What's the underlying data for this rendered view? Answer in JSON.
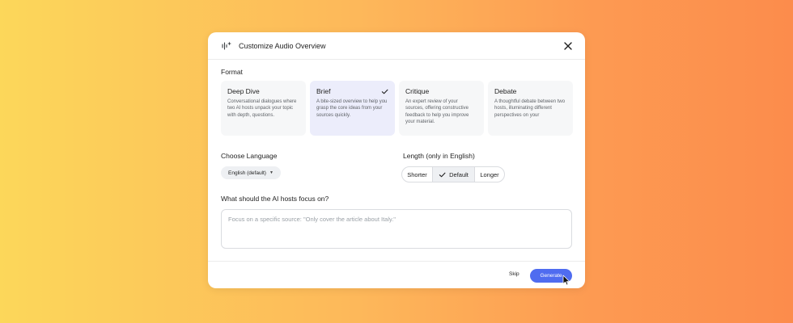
{
  "dialog": {
    "title": "Customize Audio Overview",
    "close_icon": "close-icon",
    "header_icon": "sparkle-wave-icon"
  },
  "format": {
    "label": "Format",
    "options": [
      {
        "title": "Deep Dive",
        "desc": "Conversational dialogues where two AI hosts unpack your topic with depth, questions.",
        "selected": false
      },
      {
        "title": "Brief",
        "desc": "A bite-sized overview to help you grasp the core ideas from your sources quickly.",
        "selected": true
      },
      {
        "title": "Critique",
        "desc": "An expert review of your sources, offering constructive feedback to help you improve your material.",
        "selected": false
      },
      {
        "title": "Debate",
        "desc": "A thoughtful debate between two hosts, illuminating different perspectives on your",
        "selected": false
      }
    ]
  },
  "language": {
    "label": "Choose Language",
    "selected": "English (default)"
  },
  "length": {
    "label": "Length (only in English)",
    "options": [
      "Shorter",
      "Default",
      "Longer"
    ],
    "selected": "Default"
  },
  "focus": {
    "label": "What should the AI hosts focus on?",
    "placeholder": "Focus on a specific source: \"Only cover the article about Italy.\"",
    "value": ""
  },
  "footer": {
    "skip_label": "Skip",
    "generate_label": "Generate"
  },
  "colors": {
    "accent": "#4f6cf0",
    "selected_card": "#ecedfb"
  }
}
